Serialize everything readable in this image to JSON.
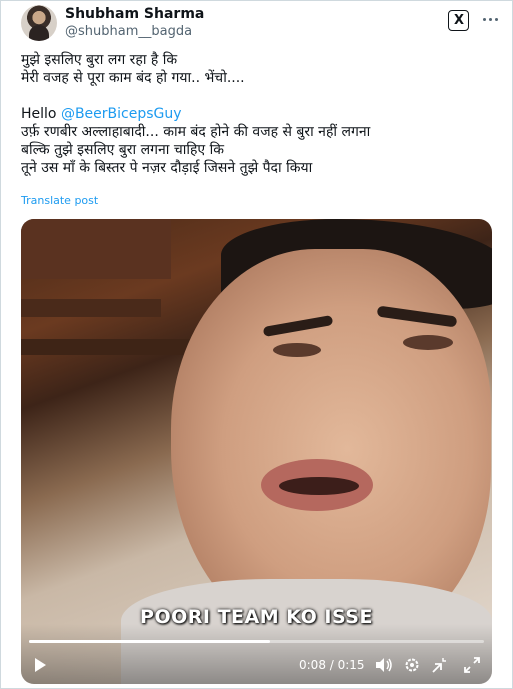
{
  "author": {
    "display_name": "Shubham Sharma",
    "handle": "@shubham__bagda"
  },
  "header_icons": {
    "brand_icon": "x-logo-icon",
    "more_icon": "more-options-icon"
  },
  "tweet": {
    "line1": "मुझे इसलिए बुरा लग रहा है कि",
    "line2": "मेरी वजह से पूरा काम बंद हो गया.. भेंचो....",
    "hello": "Hello",
    "mention": "@BeerBicepsGuy",
    "line4": "उर्फ़ रणबीर अल्लाहाबादी... काम बंद होने की वजह से बुरा नहीं लगना",
    "line5": "बल्कि तुझे इसलिए बुरा लगना चाहिए कि",
    "line6": "तूने उस माँ के बिस्तर पे नज़र दौड़ाई जिसने तुझे पैदा किया",
    "translate_label": "Translate post"
  },
  "video": {
    "caption": "POORI TEAM KO ISSE",
    "time_display": "0:08 / 0:15",
    "progress": 0.53,
    "controls": [
      "play-icon",
      "volume-icon",
      "settings-gear-icon",
      "picture-in-picture-icon",
      "fullscreen-icon"
    ]
  },
  "colors": {
    "link": "#1d9bf0",
    "secondary_text": "#536471",
    "primary_text": "#0f1419"
  }
}
